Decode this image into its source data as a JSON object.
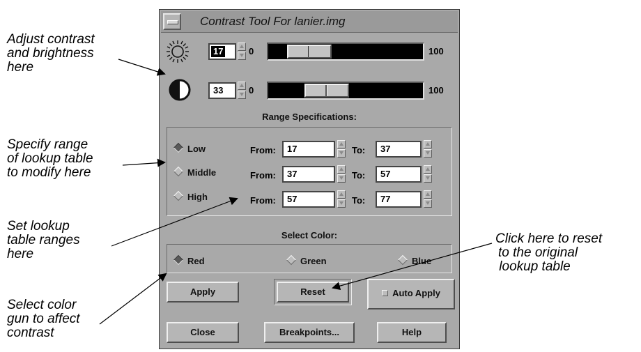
{
  "window": {
    "title": "Contrast Tool For lanier.img"
  },
  "brightness": {
    "value": "17",
    "min": "0",
    "max": "100",
    "level": 17
  },
  "contrast": {
    "value": "33",
    "min": "0",
    "max": "100",
    "level": 33
  },
  "range": {
    "heading": "Range Specifications:",
    "from_label": "From:",
    "to_label": "To:",
    "rows": [
      {
        "label": "Low",
        "selected": true,
        "from": "17",
        "to": "37"
      },
      {
        "label": "Middle",
        "selected": false,
        "from": "37",
        "to": "57"
      },
      {
        "label": "High",
        "selected": false,
        "from": "57",
        "to": "77"
      }
    ]
  },
  "color": {
    "heading": "Select Color:",
    "options": [
      {
        "label": "Red",
        "selected": true
      },
      {
        "label": "Green",
        "selected": false
      },
      {
        "label": "Blue",
        "selected": false
      }
    ]
  },
  "buttons": {
    "apply": "Apply",
    "reset": "Reset",
    "auto_apply": "Auto Apply",
    "close": "Close",
    "breakpoints": "Breakpoints...",
    "help": "Help"
  },
  "annotations": {
    "adjust": [
      "Adjust contrast",
      "and brightness",
      "here"
    ],
    "specify": [
      "Specify range",
      "of lookup table",
      "to modify here"
    ],
    "set": [
      "Set lookup",
      "table ranges",
      "here"
    ],
    "select": [
      "Select color",
      "gun to affect",
      "contrast"
    ],
    "reset": [
      "Click here to reset",
      "to the original",
      " lookup table"
    ]
  },
  "colors": {
    "window_bg": "#a9a9a9",
    "trough": "#000000",
    "field_bg": "#ffffff"
  }
}
